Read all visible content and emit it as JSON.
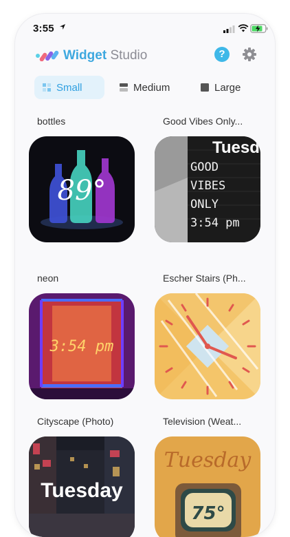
{
  "status": {
    "time": "3:55"
  },
  "header": {
    "brand_bold": "Widget",
    "brand_light": "Studio",
    "help_label": "?"
  },
  "tabs": [
    {
      "label": "Small",
      "selected": true
    },
    {
      "label": "Medium",
      "selected": false
    },
    {
      "label": "Large",
      "selected": false
    }
  ],
  "widgets": [
    {
      "title": "bottles",
      "overlay": "89°"
    },
    {
      "title": "Good Vibes Only...",
      "overlay_top": "Tuesda",
      "lines": [
        "GOOD",
        "VIBES",
        "ONLY",
        "3:54 pm"
      ]
    },
    {
      "title": "neon",
      "overlay": "3:54 pm"
    },
    {
      "title": "Escher Stairs (Ph..."
    },
    {
      "title": "Cityscape (Photo)",
      "overlay": "Tuesday"
    },
    {
      "title": "Television (Weat...",
      "overlay_top": "Tuesday",
      "overlay": "75°"
    }
  ],
  "colors": {
    "accent": "#3ea8df",
    "help": "#3fb8e8",
    "selected_tab_bg": "#e3f2fb"
  }
}
